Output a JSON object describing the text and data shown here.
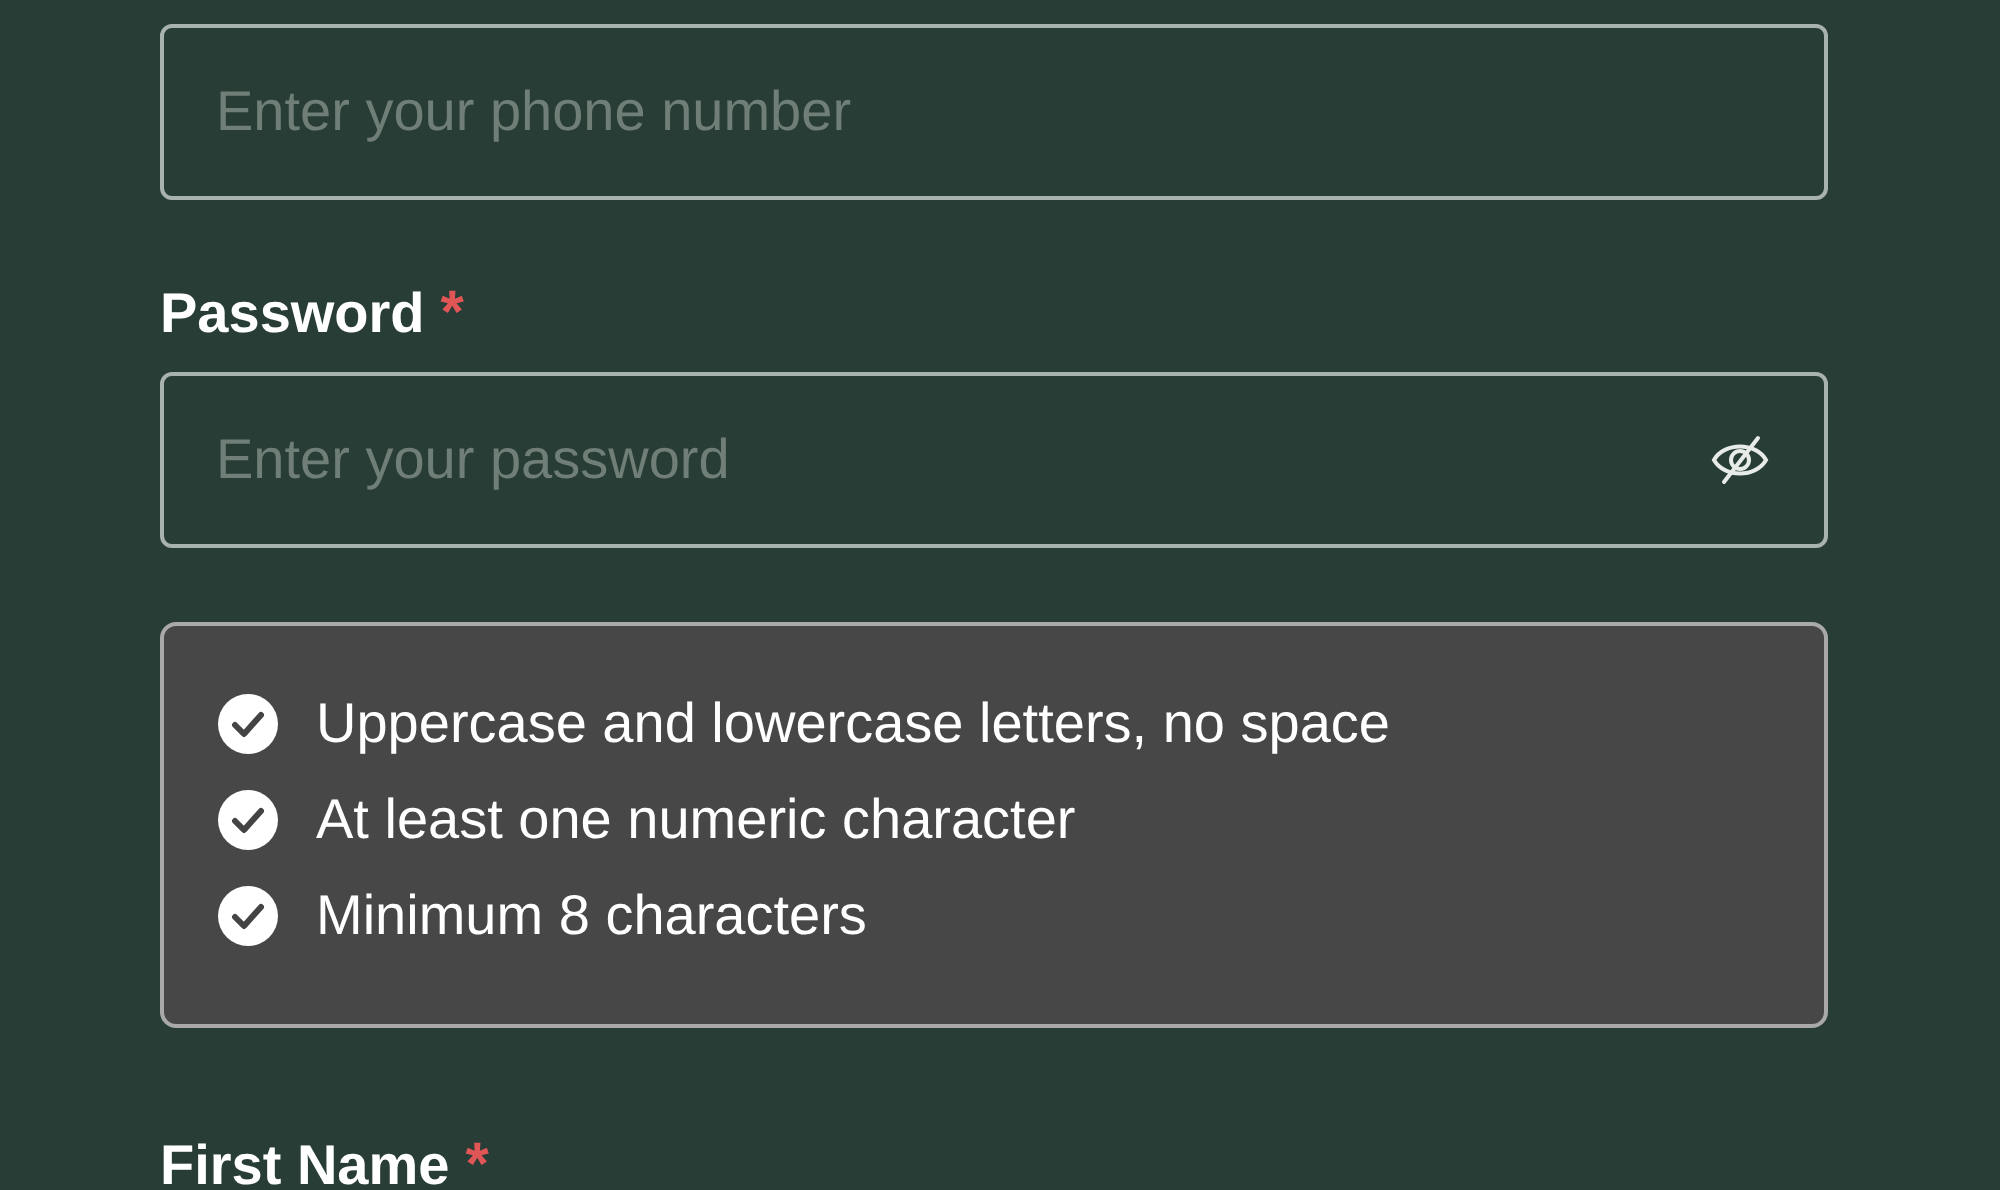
{
  "phone_field": {
    "placeholder": "Enter your phone number"
  },
  "password": {
    "label": "Password",
    "required_mark": "*",
    "placeholder": "Enter your password",
    "visible": false
  },
  "requirements": [
    {
      "text": "Uppercase and lowercase letters, no space",
      "met": true
    },
    {
      "text": "At least one numeric character",
      "met": true
    },
    {
      "text": "Minimum 8 characters",
      "met": true
    }
  ],
  "first_name": {
    "label": "First Name",
    "required_mark": "*"
  }
}
